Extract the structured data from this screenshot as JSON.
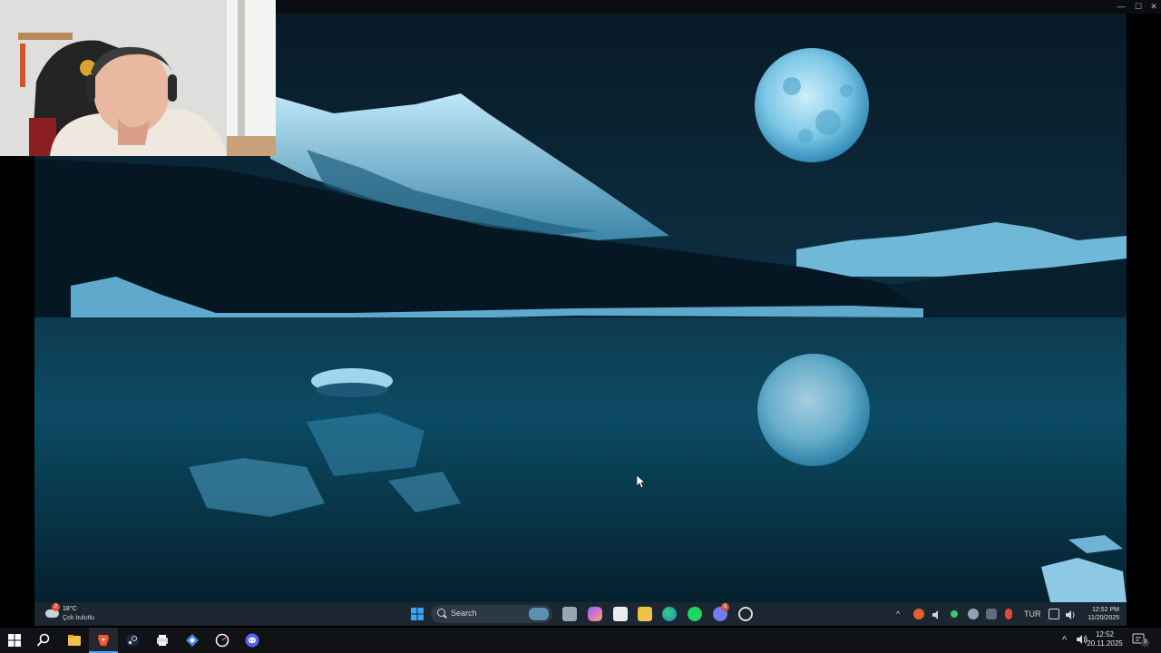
{
  "window": {
    "minimize_glyph": "—",
    "maximize_glyph": "☐",
    "close_glyph": "✕"
  },
  "webcam": {
    "description_icon": "webcam-feed-icon"
  },
  "inner_desktop": {
    "weather": {
      "badge": "2",
      "temperature": "18°C",
      "condition": "Çok bulutlu"
    },
    "search": {
      "label": "Search"
    },
    "tray": {
      "language": "TUR",
      "discord_badge": "5"
    },
    "clock": {
      "time": "12:52 PM",
      "date": "11/20/2025"
    }
  },
  "taskbar": {
    "apps": [
      {
        "name": "file-explorer",
        "icon": "folder-icon"
      },
      {
        "name": "brave",
        "icon": "brave-lion-icon"
      },
      {
        "name": "steam",
        "icon": "steam-icon"
      },
      {
        "name": "printer",
        "icon": "printer-icon"
      },
      {
        "name": "remote",
        "icon": "remote-icon"
      },
      {
        "name": "settings-app",
        "icon": "gauge-icon"
      },
      {
        "name": "discord",
        "icon": "discord-icon"
      }
    ],
    "clock": {
      "time": "12:52",
      "date": "20.11.2025"
    },
    "notification_count": "3"
  },
  "colors": {
    "accent": "#4aa3ff",
    "taskbar": "#101216",
    "inner_taskbar": "#1b2630",
    "wallpaper_sky": "#0d2c3d"
  }
}
